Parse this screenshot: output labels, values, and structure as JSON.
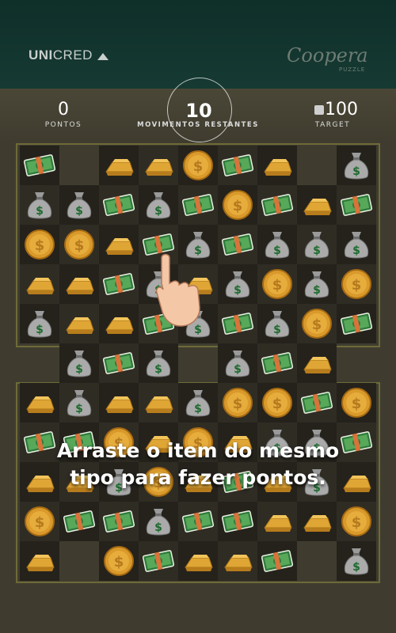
{
  "header": {
    "brand_bold": "UNI",
    "brand_rest": "CRED",
    "game_logo": "Coopera",
    "game_sub": "PUZZLE"
  },
  "stats": {
    "points_value": "0",
    "points_label": "PONTOS",
    "moves_value": "10",
    "moves_label": "MOVIMENTOS RESTANTES",
    "target_value": "100",
    "target_label": "TARGET"
  },
  "board": {
    "rows": [
      [
        "cash",
        null,
        "gold",
        "gold",
        "coin",
        "cash",
        "gold",
        null,
        "bag"
      ],
      [
        "bag",
        "bag",
        "cash",
        "bag",
        "cash",
        "coin",
        "cash",
        "gold",
        "cash"
      ],
      [
        "coin",
        "coin",
        "gold",
        "cash",
        "bag",
        "cash",
        "bag",
        "bag",
        "bag"
      ],
      [
        "gold",
        "gold",
        "cash",
        "bag",
        "gold",
        "bag",
        "coin",
        "bag",
        "coin"
      ],
      [
        "bag",
        "gold",
        "gold",
        "cash",
        "bag",
        "cash",
        "bag",
        "coin",
        "cash"
      ],
      [
        null,
        "bag",
        "cash",
        "bag",
        null,
        "bag",
        "cash",
        "gold",
        null
      ],
      [
        "gold",
        "bag",
        "gold",
        "gold",
        "bag",
        "coin",
        "coin",
        "cash",
        "coin"
      ],
      [
        "cash",
        "cash",
        "coin",
        "gold",
        "coin",
        "gold",
        "bag",
        "bag",
        "cash"
      ],
      [
        "gold",
        "gold",
        "bag",
        "coin",
        "gold",
        "cash",
        "gold",
        "bag",
        "gold"
      ],
      [
        "coin",
        "cash",
        "cash",
        "bag",
        "cash",
        "cash",
        "gold",
        "gold",
        "coin"
      ],
      [
        "gold",
        null,
        "coin",
        "cash",
        "gold",
        "gold",
        "cash",
        null,
        "bag"
      ]
    ]
  },
  "tutorial": {
    "text": "Arraste o item do mesmo tipo para fazer pontos."
  }
}
